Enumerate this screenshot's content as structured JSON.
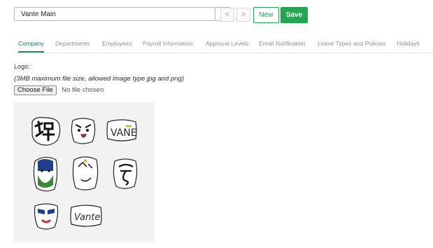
{
  "toolbar": {
    "company_select_value": "Vante Main",
    "prev_label": "<",
    "next_label": ">",
    "new_label": "New",
    "save_label": "Save",
    "accent_color": "#24a653"
  },
  "tabs": [
    {
      "label": "Company",
      "active": true
    },
    {
      "label": "Departments",
      "active": false
    },
    {
      "label": "Employees",
      "active": false
    },
    {
      "label": "Payroll Information",
      "active": false
    },
    {
      "label": "Approval Levels",
      "active": false
    },
    {
      "label": "Email Notification",
      "active": false
    },
    {
      "label": "Leave Types and Policies",
      "active": false
    },
    {
      "label": "Holidays",
      "active": false
    }
  ],
  "logo": {
    "label": "Logo:",
    "hint": "(3MB maximum file size, allowed image type jpg and png)",
    "choose_file_label": "Choose File",
    "no_file_text": "No file chosen",
    "sticker_texts": [
      "VANE",
      "Vante"
    ]
  }
}
